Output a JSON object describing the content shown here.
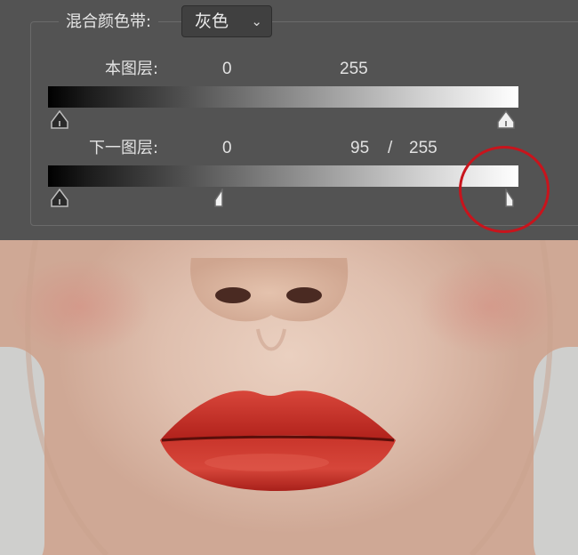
{
  "blend_if": {
    "label": "混合颜色带:",
    "select_value": "灰色",
    "select_chevron": "⌄"
  },
  "this_layer": {
    "label": "本图层:",
    "black_value": "0",
    "white_value": "255"
  },
  "underlying_layer": {
    "label": "下一图层:",
    "black_value": "0",
    "white_split_low": "95",
    "separator": "/",
    "white_split_high": "255"
  },
  "colors": {
    "panel_bg": "#535353",
    "highlight_ring": "#c8141c",
    "lip_red": "#c22a22"
  }
}
